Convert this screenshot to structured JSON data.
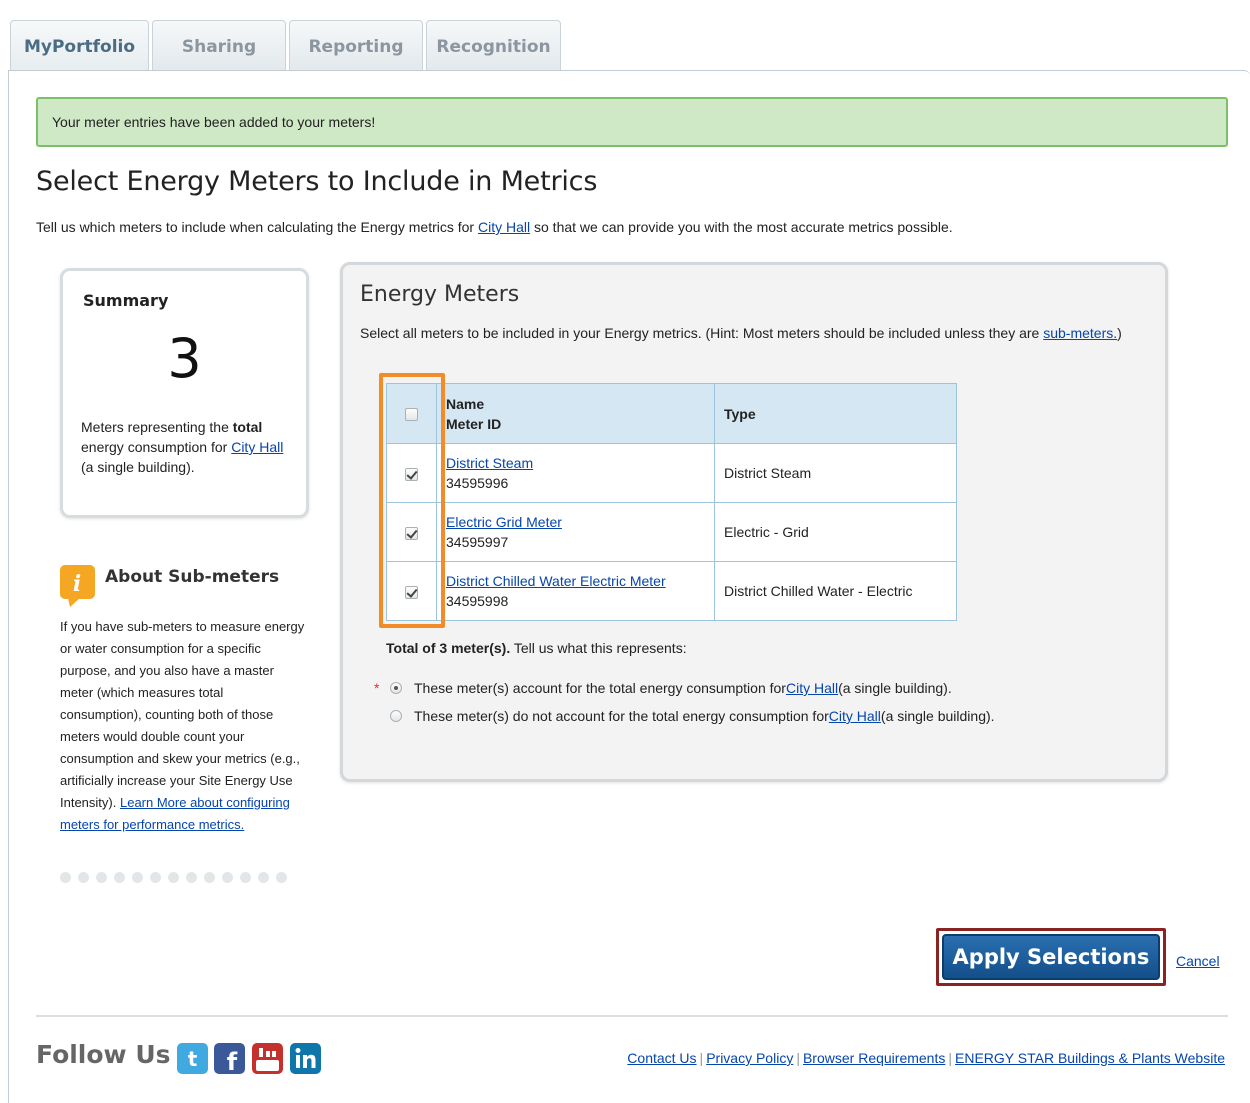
{
  "tabs": [
    {
      "label": "MyPortfolio",
      "active": true
    },
    {
      "label": "Sharing",
      "active": false
    },
    {
      "label": "Reporting",
      "active": false
    },
    {
      "label": "Recognition",
      "active": false
    }
  ],
  "success_message": "Your meter entries have been added to your meters!",
  "page_title": "Select Energy Meters to Include in Metrics",
  "intro": {
    "before": "Tell us which meters to include when calculating the Energy metrics for ",
    "link": "City Hall",
    "after": " so that we can provide you with the most accurate metrics possible."
  },
  "summary": {
    "title": "Summary",
    "count": "3",
    "desc_1": "Meters representing the ",
    "desc_bold": "total",
    "desc_2": " energy consumption for ",
    "desc_link": "City Hall",
    "desc_3": " (a single building)."
  },
  "about": {
    "title": "About Sub-meters",
    "body": "If you have sub-meters to measure energy or water consumption for a specific purpose, and you also have a master meter (which measures total consumption), counting both of those meters would double count your consumption and skew your metrics (e.g., artificially increase your Site Energy Use Intensity).",
    "link": "Learn More about configuring meters for performance metrics."
  },
  "meters": {
    "title": "Energy Meters",
    "hint_before": "Select all meters to be included in your Energy metrics. (Hint: Most meters should be included unless they are ",
    "hint_link": "sub-meters.",
    "hint_after": ")",
    "header": {
      "name": "Name",
      "meter_id": "Meter ID",
      "type": "Type"
    },
    "rows": [
      {
        "name": "District Steam",
        "id": "34595996",
        "type": "District Steam",
        "checked": true
      },
      {
        "name": "Electric Grid Meter",
        "id": "34595997",
        "type": "Electric - Grid",
        "checked": true
      },
      {
        "name": "District Chilled Water Electric Meter",
        "id": "34595998",
        "type": "District Chilled Water - Electric",
        "checked": true
      }
    ],
    "total_bold": "Total of 3 meter(s).",
    "total_rest": " Tell us what this represents:",
    "options": [
      {
        "before": "These meter(s) account for the total energy consumption for ",
        "link": "City Hall",
        "after": " (a single building).",
        "selected": true
      },
      {
        "before": "These meter(s) do not account for the total energy consumption for ",
        "link": "City Hall",
        "after": " (a single building).",
        "selected": false
      }
    ],
    "required_mark": "*"
  },
  "actions": {
    "apply": "Apply Selections",
    "cancel": "Cancel"
  },
  "footer": {
    "follow": "Follow Us",
    "social": [
      "twitter-icon",
      "facebook-icon",
      "youtube-icon",
      "linkedin-icon"
    ],
    "links": [
      "Contact Us",
      "Privacy Policy",
      "Browser Requirements",
      "ENERGY STAR Buildings & Plants Website"
    ],
    "separator": "|"
  },
  "colors": {
    "success_bg": "#cfe8c5",
    "success_border": "#7cbf68",
    "highlight_orange": "#f28c28",
    "apply_blue": "#1a5e9e",
    "apply_outline": "#8b2323",
    "table_header": "#d5e7f2",
    "info_icon": "#f5a623"
  }
}
